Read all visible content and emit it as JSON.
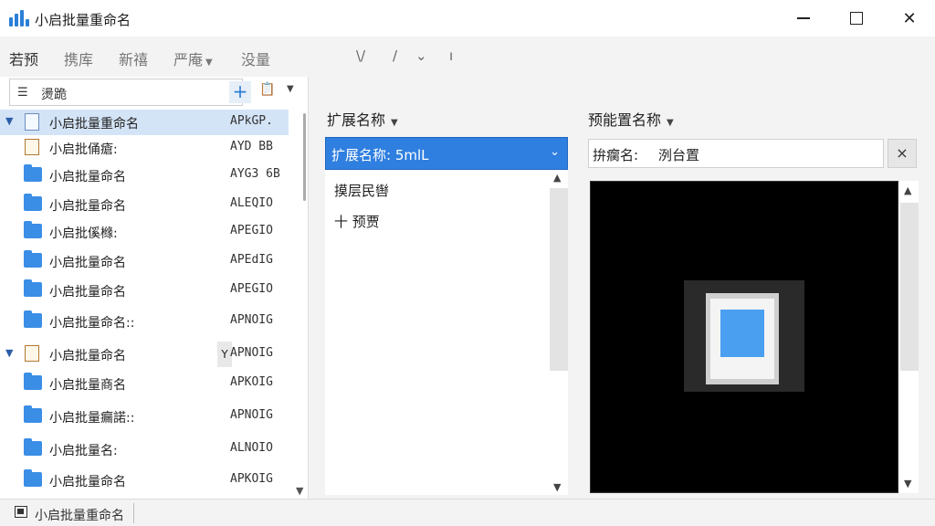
{
  "window": {
    "title": "小启批量重命名"
  },
  "menu": {
    "items": [
      "若预",
      "携库",
      "新禧",
      "严庵",
      "没量"
    ],
    "glyphs": [
      "\\/",
      "/",
      "⌄",
      "ı"
    ]
  },
  "search": {
    "icon": "list-icon",
    "text": "燙跪",
    "add_label": "+"
  },
  "tree": {
    "rows": [
      {
        "name": "小启批量重命名",
        "code": "APkGP.",
        "icon": "doc",
        "expand": "▼"
      },
      {
        "name": "小启批俑瘡:",
        "code": "AYD BB",
        "icon": "doc2",
        "expand": ""
      },
      {
        "name": "小启批量命名",
        "code": "AYG3 6B",
        "icon": "folder",
        "expand": ""
      },
      {
        "name": "小启批量命名",
        "code": "ALEQIO",
        "icon": "folder",
        "expand": ""
      },
      {
        "name": "小启批傒橼:",
        "code": "APEGIO",
        "icon": "folder",
        "expand": ""
      },
      {
        "name": "小启批量命名",
        "code": "APEdIG",
        "icon": "folder",
        "expand": ""
      },
      {
        "name": "小启批量命名",
        "code": "APEGIO",
        "icon": "folder",
        "expand": ""
      },
      {
        "name": "小启批量命名::",
        "code": "APNOIG",
        "icon": "folder",
        "expand": ""
      },
      {
        "name": "小启批量命名",
        "code": "APNOIG",
        "icon": "doc2",
        "expand": "▼",
        "tag": "Y"
      },
      {
        "name": "小启批量商名",
        "code": "APKOIG",
        "icon": "folder",
        "expand": ""
      },
      {
        "name": "小启批量瘺諾::",
        "code": "APNOIG",
        "icon": "folder",
        "expand": ""
      },
      {
        "name": "小启批量名:",
        "code": "ALNOIO",
        "icon": "folder",
        "expand": ""
      },
      {
        "name": "小启批量命名",
        "code": "APKOIG",
        "icon": "folder",
        "expand": ""
      }
    ]
  },
  "status": {
    "text": "小启批量重命名"
  },
  "middle": {
    "header": "扩展名称",
    "select_value": "扩展名称: 5mlL",
    "list_items": [
      "摸层民辔",
      "十 预贾"
    ]
  },
  "right": {
    "header": "预能置名称",
    "new_name_label": "拚瘸名:",
    "new_name_value": "洌台置",
    "clear_label": "×"
  },
  "colors": {
    "accent": "#2f7fe0",
    "folder": "#3a8ee6",
    "selection": "#d4e4f7"
  }
}
